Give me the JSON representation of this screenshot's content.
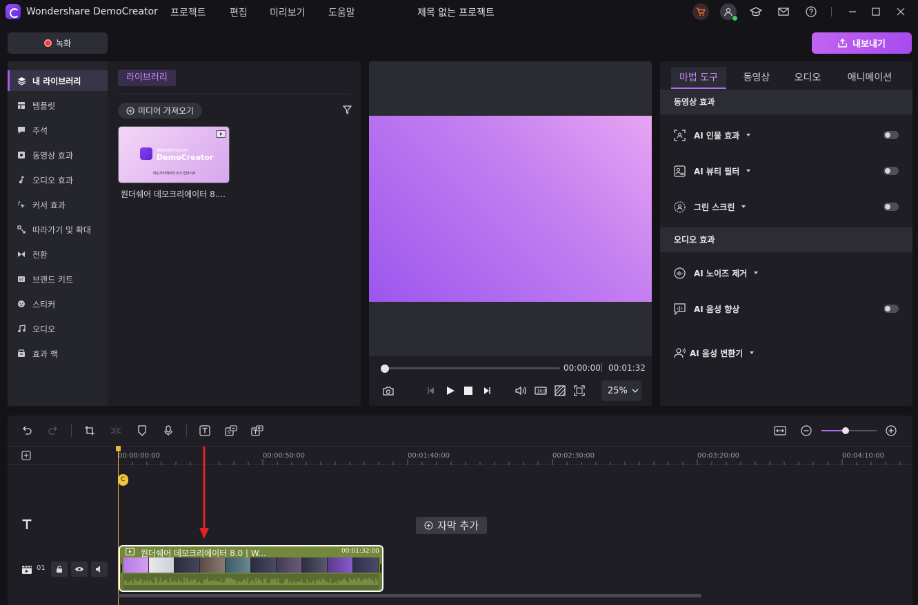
{
  "app": {
    "name": "Wondershare DemoCreator",
    "menu": [
      "프로젝트",
      "편집",
      "미리보기",
      "도움말"
    ],
    "project_title": "제목 없는 프로젝트"
  },
  "toolbar": {
    "record_label": "녹화",
    "export_label": "내보내기"
  },
  "library": {
    "sidebar": [
      {
        "label": "내 라이브러리",
        "icon": "layers-icon",
        "active": true
      },
      {
        "label": "템플릿",
        "icon": "template-icon"
      },
      {
        "label": "주석",
        "icon": "annotation-icon"
      },
      {
        "label": "동영상 효과",
        "icon": "video-effect-icon"
      },
      {
        "label": "오디오 효과",
        "icon": "audio-effect-icon"
      },
      {
        "label": "커서 효과",
        "icon": "cursor-effect-icon"
      },
      {
        "label": "따라가기 및 확대",
        "icon": "zoom-follow-icon"
      },
      {
        "label": "전환",
        "icon": "transition-icon"
      },
      {
        "label": "브랜드 키트",
        "icon": "brand-kit-icon"
      },
      {
        "label": "스티커",
        "icon": "sticker-icon"
      },
      {
        "label": "오디오",
        "icon": "music-icon"
      },
      {
        "label": "효과 팩",
        "icon": "effect-pack-icon"
      }
    ],
    "tab_label": "라이브러리",
    "import_label": "미디어 가져오기",
    "media": [
      {
        "name": "원더쉐어 데모크리에이터 8....",
        "thumb_brand_small": "Wondershare",
        "thumb_brand": "DemoCreator",
        "thumb_caption": "데모크리에이터 8.0 업데이트"
      }
    ]
  },
  "preview": {
    "current_time": "00:00:00",
    "total_time": "00:01:32",
    "zoom": "25%",
    "progress": 0
  },
  "fx_panel": {
    "tabs": [
      "마법 도구",
      "동영상",
      "오디오",
      "애니메이션"
    ],
    "active_tab": "마법 도구",
    "sections": [
      {
        "title": "동영상 효과",
        "items": [
          {
            "label": "AI 인물 효과",
            "toggle": false
          },
          {
            "label": "AI 뷰티 필터",
            "toggle": false
          },
          {
            "label": "그린 스크린",
            "toggle": false
          }
        ]
      },
      {
        "title": "오디오 효과",
        "items": [
          {
            "label": "AI 노이즈 제거"
          },
          {
            "label": "AI 음성 향상",
            "toggle": false
          },
          {
            "label": "AI 음성 변환기"
          }
        ]
      }
    ]
  },
  "timeline": {
    "ruler_labels": [
      "00:00:00:00",
      "00:00:50:00",
      "00:01:40:00",
      "00:02:30:00",
      "00:03:20:00",
      "00:04:10:00"
    ],
    "marker_label": "C",
    "add_subtitle_label": "자막 추가",
    "track_number": "01",
    "clip": {
      "title": "원더쉐어 데모크리에이터 8.0 | W...",
      "duration": "00:01:32:00"
    },
    "zoom_level": 0.45
  },
  "colors": {
    "accent": "#b06df5",
    "export_gradient_start": "#c263f0",
    "playhead": "#e9b63c",
    "clip": "#6b7d3a",
    "record": "#f03a3a",
    "arrow": "#e02424"
  }
}
